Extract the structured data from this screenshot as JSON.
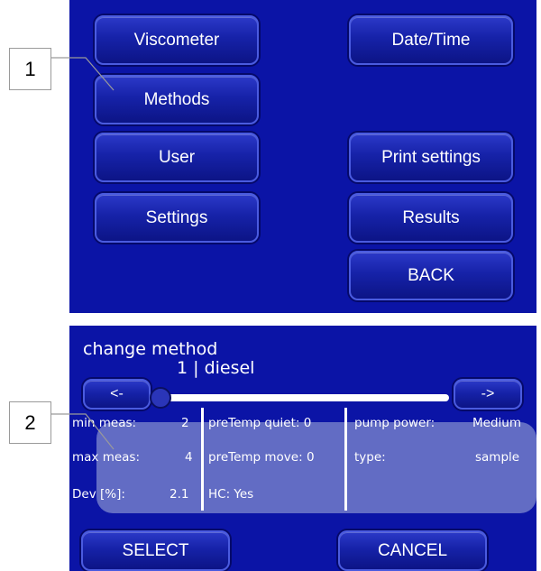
{
  "callouts": {
    "one": "1",
    "two": "2"
  },
  "menu": {
    "viscometer": "Viscometer",
    "date_time": "Date/Time",
    "methods": "Methods",
    "user": "User",
    "print_settings": "Print settings",
    "settings": "Settings",
    "results": "Results",
    "back": "BACK"
  },
  "change_method": {
    "title": "change method",
    "current": "1 | diesel",
    "prev_label": "<-",
    "next_label": "->",
    "slider_position": 0,
    "params": {
      "min_meas_label": "min meas:",
      "min_meas_value": "2",
      "max_meas_label": "max meas:",
      "max_meas_value": "4",
      "dev_label": "Dev [%]:",
      "dev_value": "2.1",
      "pretemp_quiet": "preTemp quiet: 0",
      "pretemp_move": "preTemp move: 0",
      "hc": "HC: Yes",
      "pump_power_label": "pump power:",
      "pump_power_value": "Medium",
      "type_label": "type:",
      "type_value": "sample"
    },
    "select_label": "SELECT",
    "cancel_label": "CANCEL"
  },
  "colors": {
    "screen_bg": "#0b14a6",
    "button": "#1622a8",
    "panel": "#6c76c8"
  }
}
